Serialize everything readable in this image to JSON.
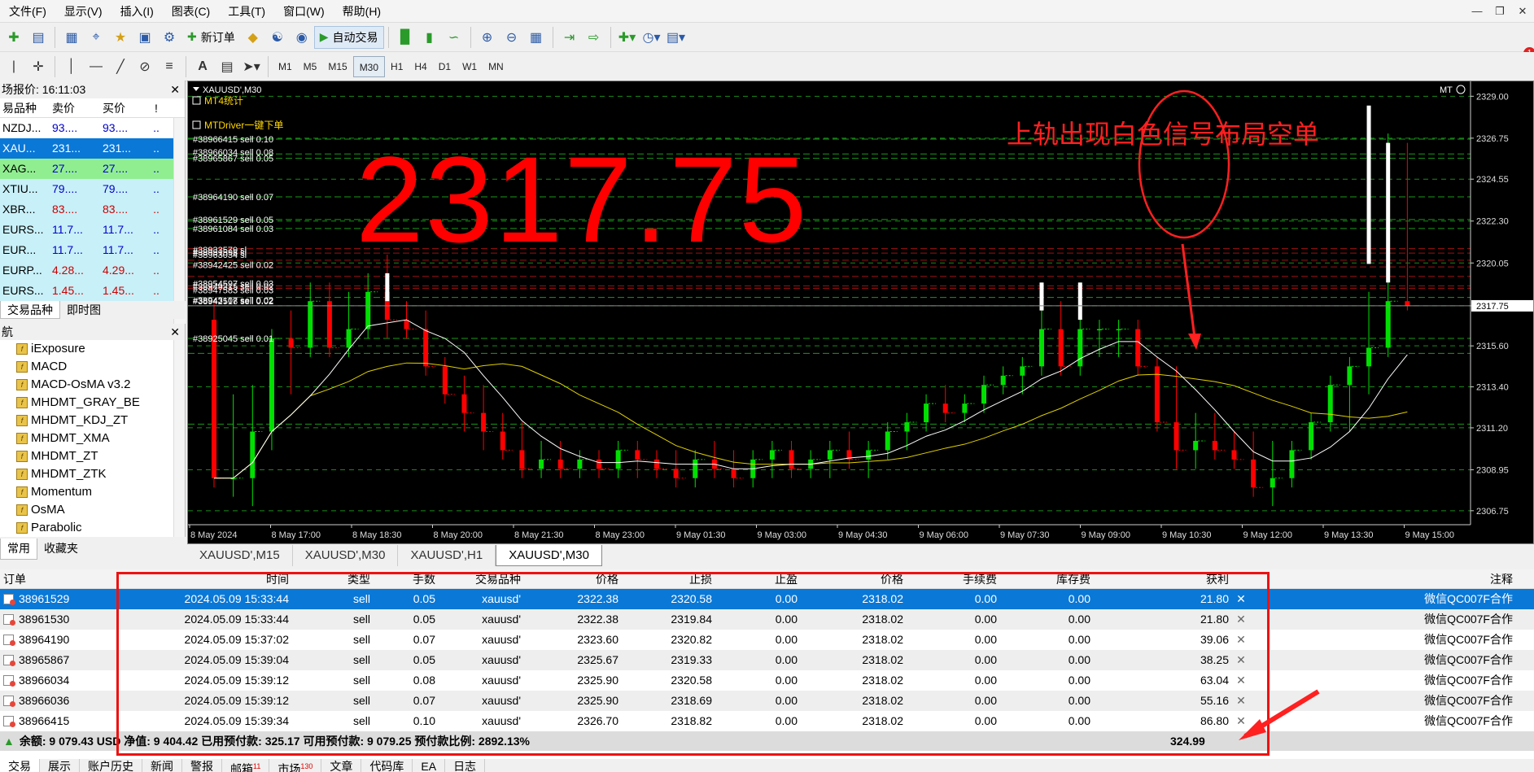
{
  "menu": [
    "文件(F)",
    "显示(V)",
    "插入(I)",
    "图表(C)",
    "工具(T)",
    "窗口(W)",
    "帮助(H)"
  ],
  "toolbar": {
    "new_order": "新订单",
    "auto_trade": "自动交易",
    "timeframes": [
      "M1",
      "M5",
      "M15",
      "M30",
      "H1",
      "H4",
      "D1",
      "W1",
      "MN"
    ],
    "active_tf": "M30"
  },
  "notification_count": "1",
  "market_watch": {
    "title": "场报价: 16:11:03",
    "columns": [
      "易品种",
      "卖价",
      "买价",
      "!"
    ],
    "rows": [
      {
        "sym": "NZDJ...",
        "bid": "93....",
        "ask": "93....",
        "ex": "..",
        "bg": "#ffffff",
        "color": "#0000cc"
      },
      {
        "sym": "XAU...",
        "bid": "231...",
        "ask": "231...",
        "ex": "..",
        "bg": "#0a78d7",
        "color": "#ffffff"
      },
      {
        "sym": "XAG...",
        "bid": "27....",
        "ask": "27....",
        "ex": "..",
        "bg": "#90ee90",
        "color": "#0000cc"
      },
      {
        "sym": "XTIU...",
        "bid": "79....",
        "ask": "79....",
        "ex": "..",
        "bg": "#c8f0f8",
        "color": "#0000cc"
      },
      {
        "sym": "XBR...",
        "bid": "83....",
        "ask": "83....",
        "ex": "..",
        "bg": "#c8f0f8",
        "color": "#cc0000"
      },
      {
        "sym": "EURS...",
        "bid": "11.7...",
        "ask": "11.7...",
        "ex": "..",
        "bg": "#c8f0f8",
        "color": "#0000cc"
      },
      {
        "sym": "EUR...",
        "bid": "11.7...",
        "ask": "11.7...",
        "ex": "..",
        "bg": "#c8f0f8",
        "color": "#0000cc"
      },
      {
        "sym": "EURP...",
        "bid": "4.28...",
        "ask": "4.29...",
        "ex": "..",
        "bg": "#c8f0f8",
        "color": "#cc0000"
      },
      {
        "sym": "EURS...",
        "bid": "1.45...",
        "ask": "1.45...",
        "ex": "..",
        "bg": "#c8f0f8",
        "color": "#cc0000"
      }
    ],
    "tabs": [
      "交易品种",
      "即时图"
    ]
  },
  "navigator": {
    "title": "航",
    "items": [
      "iExposure",
      "MACD",
      "MACD-OsMA v3.2",
      "MHDMT_GRAY_BE",
      "MHDMT_KDJ_ZT",
      "MHDMT_XMA",
      "MHDMT_ZT",
      "MHDMT_ZTK",
      "Momentum",
      "OsMA",
      "Parabolic"
    ],
    "tabs": [
      "常用",
      "收藏夹"
    ]
  },
  "chart": {
    "title": "XAUUSD',M30",
    "mt_label": "MT",
    "indicator_labels": [
      "MT4统计",
      "MTDriver一键下单"
    ],
    "big_price": "2317.75",
    "annotation": "上轨出现白色信号布局空单",
    "price_axis": [
      "2329.00",
      "2326.75",
      "2324.55",
      "2322.30",
      "2320.05",
      "2317.75",
      "2315.60",
      "2313.40",
      "2311.20",
      "2308.95",
      "2306.75"
    ],
    "current_price": "2317.75",
    "time_axis": [
      "8 May 2024",
      "8 May 17:00",
      "8 May 18:30",
      "8 May 20:00",
      "8 May 21:30",
      "8 May 23:00",
      "9 May 01:30",
      "9 May 03:00",
      "9 May 04:30",
      "9 May 06:00",
      "9 May 07:30",
      "9 May 09:00",
      "9 May 10:30",
      "9 May 12:00",
      "9 May 13:30",
      "9 May 15:00"
    ],
    "order_labels": [
      "#38966415 sell 0.10",
      "#38966034 sell 0.08",
      "#38965867 sell 0.05",
      "#38964190 sell 0.07",
      "#38961529 sell 0.05",
      "#38961084 sell 0.03",
      "#38933579 sl",
      "#38951598 sl",
      "#38963034 sl",
      "#38942425 sell 0.02",
      "#38954597 sell 0.03",
      "#38949315 sell 0.02",
      "#38947583 sell 0.03",
      "#38943107 sell 0.02",
      "#38942518 sell 0.02",
      "#38925045 sell 0.01"
    ],
    "colors": {
      "bull": "#00e000",
      "bear": "#ff0000",
      "signal": "#ffffff",
      "ma_fast": "#ffffff",
      "ma_slow": "#e0d000",
      "grid": "#1a8a1a"
    }
  },
  "chart_data": {
    "type": "candlestick",
    "title": "XAUUSD',M30",
    "ylim": [
      2306.0,
      2329.8
    ],
    "candles": [
      [
        2317.0,
        2318.0,
        2308.0,
        2308.5
      ],
      [
        2308.5,
        2313.0,
        2307.5,
        2308.5
      ],
      [
        2308.5,
        2313.5,
        2307.0,
        2311.0
      ],
      [
        2311.0,
        2316.5,
        2310.0,
        2316.0
      ],
      [
        2316.0,
        2317.5,
        2313.0,
        2315.5
      ],
      [
        2315.5,
        2319.0,
        2315.0,
        2318.0
      ],
      [
        2318.0,
        2319.0,
        2315.0,
        2315.5
      ],
      [
        2315.5,
        2318.5,
        2315.0,
        2316.5
      ],
      [
        2316.5,
        2319.5,
        2316.0,
        2318.5
      ],
      [
        2318.5,
        2320.5,
        2316.0,
        2317.0
      ],
      [
        2317.0,
        2318.0,
        2316.0,
        2316.5
      ],
      [
        2316.5,
        2317.5,
        2314.0,
        2314.5
      ],
      [
        2314.5,
        2315.0,
        2312.5,
        2313.0
      ],
      [
        2313.0,
        2314.0,
        2311.0,
        2312.0
      ],
      [
        2312.0,
        2313.5,
        2310.0,
        2311.0
      ],
      [
        2311.0,
        2312.0,
        2309.5,
        2310.0
      ],
      [
        2310.0,
        2311.5,
        2308.5,
        2309.0
      ],
      [
        2309.0,
        2310.5,
        2308.5,
        2309.5
      ],
      [
        2309.5,
        2310.5,
        2308.5,
        2309.0
      ],
      [
        2309.0,
        2310.0,
        2308.5,
        2309.5
      ],
      [
        2309.5,
        2310.0,
        2308.5,
        2309.0
      ],
      [
        2309.0,
        2310.5,
        2308.5,
        2310.0
      ],
      [
        2310.0,
        2310.5,
        2308.5,
        2309.5
      ],
      [
        2309.5,
        2310.0,
        2308.5,
        2309.0
      ],
      [
        2309.0,
        2310.0,
        2308.0,
        2308.5
      ],
      [
        2308.5,
        2310.0,
        2308.0,
        2309.5
      ],
      [
        2309.5,
        2310.5,
        2308.5,
        2309.0
      ],
      [
        2309.0,
        2310.0,
        2308.0,
        2308.5
      ],
      [
        2308.5,
        2310.0,
        2308.0,
        2309.5
      ],
      [
        2309.5,
        2310.5,
        2308.5,
        2310.0
      ],
      [
        2310.0,
        2310.5,
        2308.5,
        2309.0
      ],
      [
        2309.0,
        2310.0,
        2308.5,
        2309.5
      ],
      [
        2309.5,
        2310.5,
        2308.5,
        2310.0
      ],
      [
        2310.0,
        2311.0,
        2309.0,
        2309.5
      ],
      [
        2309.5,
        2310.5,
        2308.5,
        2310.0
      ],
      [
        2310.0,
        2311.5,
        2309.5,
        2311.0
      ],
      [
        2311.0,
        2312.0,
        2310.0,
        2311.5
      ],
      [
        2311.5,
        2313.0,
        2311.0,
        2312.5
      ],
      [
        2312.5,
        2313.5,
        2311.5,
        2312.0
      ],
      [
        2312.0,
        2313.0,
        2311.5,
        2312.5
      ],
      [
        2312.5,
        2314.0,
        2312.0,
        2313.5
      ],
      [
        2313.5,
        2314.5,
        2313.0,
        2314.0
      ],
      [
        2314.0,
        2315.0,
        2313.0,
        2314.5
      ],
      [
        2314.5,
        2319.0,
        2314.0,
        2316.5
      ],
      [
        2316.5,
        2318.0,
        2314.0,
        2314.5
      ],
      [
        2314.5,
        2319.0,
        2314.0,
        2316.5
      ],
      [
        2316.5,
        2317.0,
        2315.0,
        2316.5
      ],
      [
        2316.5,
        2317.0,
        2315.0,
        2316.5
      ],
      [
        2316.5,
        2317.0,
        2314.0,
        2314.5
      ],
      [
        2314.5,
        2315.0,
        2311.0,
        2311.5
      ],
      [
        2311.5,
        2314.5,
        2309.0,
        2310.0
      ],
      [
        2310.0,
        2312.0,
        2309.0,
        2310.5
      ],
      [
        2310.5,
        2312.0,
        2309.5,
        2310.0
      ],
      [
        2310.0,
        2311.0,
        2309.0,
        2309.5
      ],
      [
        2309.5,
        2311.0,
        2307.5,
        2308.0
      ],
      [
        2308.0,
        2310.5,
        2307.0,
        2308.5
      ],
      [
        2308.5,
        2310.5,
        2308.0,
        2310.0
      ],
      [
        2310.0,
        2312.0,
        2309.5,
        2311.5
      ],
      [
        2311.5,
        2314.0,
        2311.0,
        2313.5
      ],
      [
        2313.5,
        2315.0,
        2311.0,
        2314.5
      ],
      [
        2314.5,
        2318.5,
        2313.0,
        2315.5
      ],
      [
        2315.5,
        2327.0,
        2315.0,
        2318.0
      ],
      [
        2318.0,
        2326.5,
        2317.5,
        2317.75
      ]
    ],
    "last_price": 2317.75
  },
  "orders_table": {
    "columns": [
      "订单",
      "时间",
      "类型",
      "手数",
      "交易品种",
      "价格",
      "止损",
      "止盈",
      "价格",
      "手续费",
      "库存费",
      "获利",
      "",
      "注释"
    ],
    "rows": [
      [
        "38961529",
        "2024.05.09 15:33:44",
        "sell",
        "0.05",
        "xauusd'",
        "2322.38",
        "2320.58",
        "0.00",
        "2318.02",
        "0.00",
        "0.00",
        "21.80",
        "微信QC007F合作"
      ],
      [
        "38961530",
        "2024.05.09 15:33:44",
        "sell",
        "0.05",
        "xauusd'",
        "2322.38",
        "2319.84",
        "0.00",
        "2318.02",
        "0.00",
        "0.00",
        "21.80",
        "微信QC007F合作"
      ],
      [
        "38964190",
        "2024.05.09 15:37:02",
        "sell",
        "0.07",
        "xauusd'",
        "2323.60",
        "2320.82",
        "0.00",
        "2318.02",
        "0.00",
        "0.00",
        "39.06",
        "微信QC007F合作"
      ],
      [
        "38965867",
        "2024.05.09 15:39:04",
        "sell",
        "0.05",
        "xauusd'",
        "2325.67",
        "2319.33",
        "0.00",
        "2318.02",
        "0.00",
        "0.00",
        "38.25",
        "微信QC007F合作"
      ],
      [
        "38966034",
        "2024.05.09 15:39:12",
        "sell",
        "0.08",
        "xauusd'",
        "2325.90",
        "2320.58",
        "0.00",
        "2318.02",
        "0.00",
        "0.00",
        "63.04",
        "微信QC007F合作"
      ],
      [
        "38966036",
        "2024.05.09 15:39:12",
        "sell",
        "0.07",
        "xauusd'",
        "2325.90",
        "2318.69",
        "0.00",
        "2318.02",
        "0.00",
        "0.00",
        "55.16",
        "微信QC007F合作"
      ],
      [
        "38966415",
        "2024.05.09 15:39:34",
        "sell",
        "0.10",
        "xauusd'",
        "2326.70",
        "2318.82",
        "0.00",
        "2318.02",
        "0.00",
        "0.00",
        "86.80",
        "微信QC007F合作"
      ]
    ],
    "balance_line": "余额: 9 079.43 USD  净值: 9 404.42  已用预付款: 325.17  可用预付款: 9 079.25  预付款比例: 2892.13%",
    "total_profit": "324.99"
  },
  "chart_tabs": [
    "XAUUSD',M15",
    "XAUUSD',M30",
    "XAUUSD',H1",
    "XAUUSD',M30"
  ],
  "terminal_tabs": [
    {
      "label": "交易",
      "badge": ""
    },
    {
      "label": "展示",
      "badge": ""
    },
    {
      "label": "账户历史",
      "badge": ""
    },
    {
      "label": "新闻",
      "badge": ""
    },
    {
      "label": "警报",
      "badge": ""
    },
    {
      "label": "邮箱",
      "badge": "11"
    },
    {
      "label": "市场",
      "badge": "130"
    },
    {
      "label": "文章",
      "badge": ""
    },
    {
      "label": "代码库",
      "badge": ""
    },
    {
      "label": "EA",
      "badge": ""
    },
    {
      "label": "日志",
      "badge": ""
    }
  ]
}
